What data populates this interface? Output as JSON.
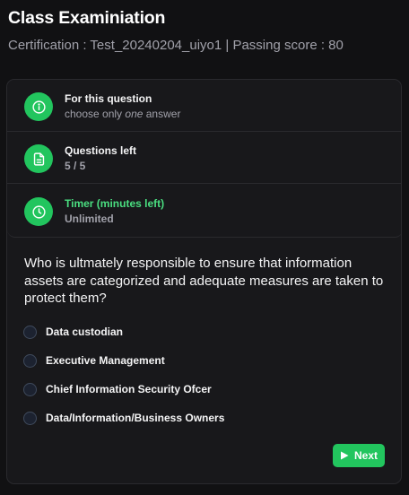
{
  "header": {
    "title": "Class Examiniation",
    "meta": "Certification : Test_20240204_uiyo1 | Passing score : 80"
  },
  "info": {
    "instruction": {
      "icon": "info-icon",
      "title": "For this question",
      "sub_prefix": "choose only ",
      "sub_emphasis": "one",
      "sub_suffix": " answer"
    },
    "questions_left": {
      "icon": "document-icon",
      "title": "Questions left",
      "value": "5 / 5"
    },
    "timer": {
      "icon": "clock-icon",
      "title": "Timer (minutes left)",
      "value": "Unlimited"
    }
  },
  "question": {
    "text": "Who is ultmately responsible to ensure that information assets are categorized and adequate measures are taken to protect them?",
    "options": [
      "Data custodian",
      "Executive Management",
      "Chief Information Security Ofcer",
      "Data/Information/Business Owners"
    ]
  },
  "actions": {
    "next_label": "Next",
    "next_icon": "play-icon"
  },
  "colors": {
    "accent": "#22c55e",
    "timer_title": "#4ade80",
    "background": "#111113",
    "card": "#18181b"
  }
}
